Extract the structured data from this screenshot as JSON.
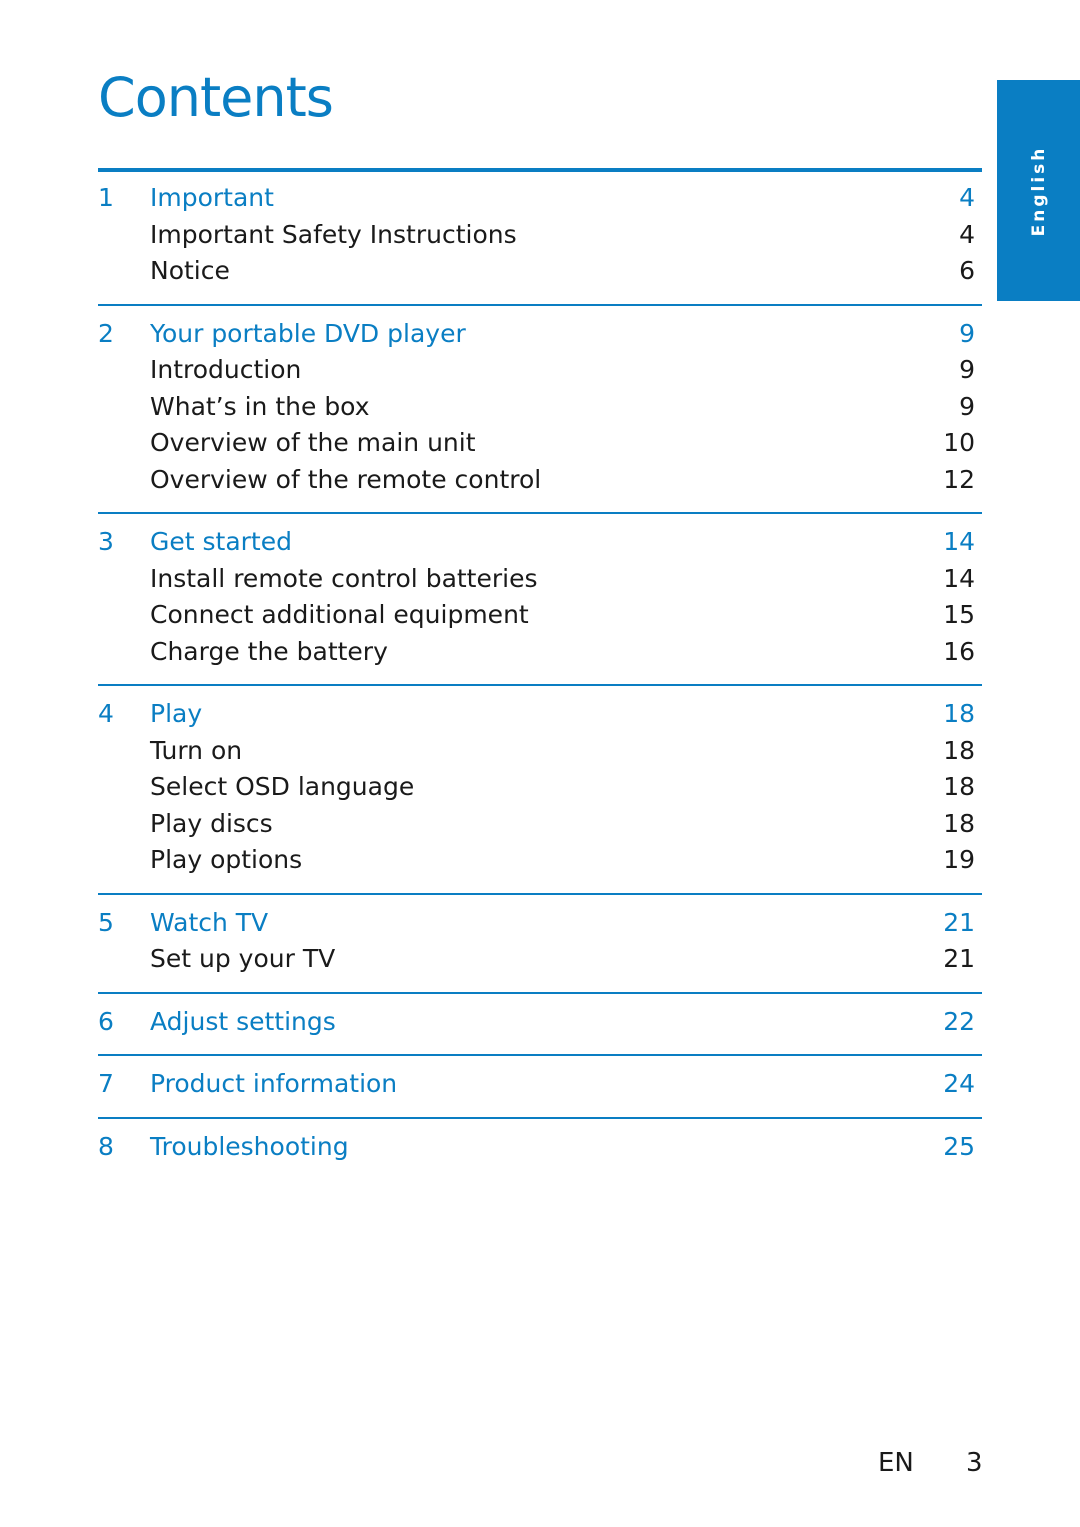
{
  "page": {
    "title": "Contents",
    "language_tab": "English",
    "footer": {
      "lang": "EN",
      "page_number": "3"
    },
    "accent_color": "#0a7ec3"
  },
  "sections": [
    {
      "number": "1",
      "title": "Important",
      "page": "4",
      "items": [
        {
          "label": "Important Safety Instructions",
          "page": "4"
        },
        {
          "label": "Notice",
          "page": "6"
        }
      ]
    },
    {
      "number": "2",
      "title": "Your portable DVD player",
      "page": "9",
      "items": [
        {
          "label": "Introduction",
          "page": "9"
        },
        {
          "label": "What’s in the box",
          "page": "9"
        },
        {
          "label": "Overview of the main unit",
          "page": "10"
        },
        {
          "label": "Overview of the remote control",
          "page": "12"
        }
      ]
    },
    {
      "number": "3",
      "title": "Get started",
      "page": "14",
      "items": [
        {
          "label": "Install remote control batteries",
          "page": "14"
        },
        {
          "label": "Connect additional equipment",
          "page": "15"
        },
        {
          "label": "Charge the battery",
          "page": "16"
        }
      ]
    },
    {
      "number": "4",
      "title": "Play",
      "page": "18",
      "items": [
        {
          "label": "Turn on",
          "page": "18"
        },
        {
          "label": "Select OSD language",
          "page": "18"
        },
        {
          "label": "Play discs",
          "page": "18"
        },
        {
          "label": "Play options",
          "page": "19"
        }
      ]
    },
    {
      "number": "5",
      "title": "Watch TV",
      "page": "21",
      "items": [
        {
          "label": "Set up your TV",
          "page": "21"
        }
      ]
    },
    {
      "number": "6",
      "title": "Adjust settings",
      "page": "22",
      "items": []
    },
    {
      "number": "7",
      "title": "Product information",
      "page": "24",
      "items": []
    },
    {
      "number": "8",
      "title": "Troubleshooting",
      "page": "25",
      "items": []
    }
  ]
}
